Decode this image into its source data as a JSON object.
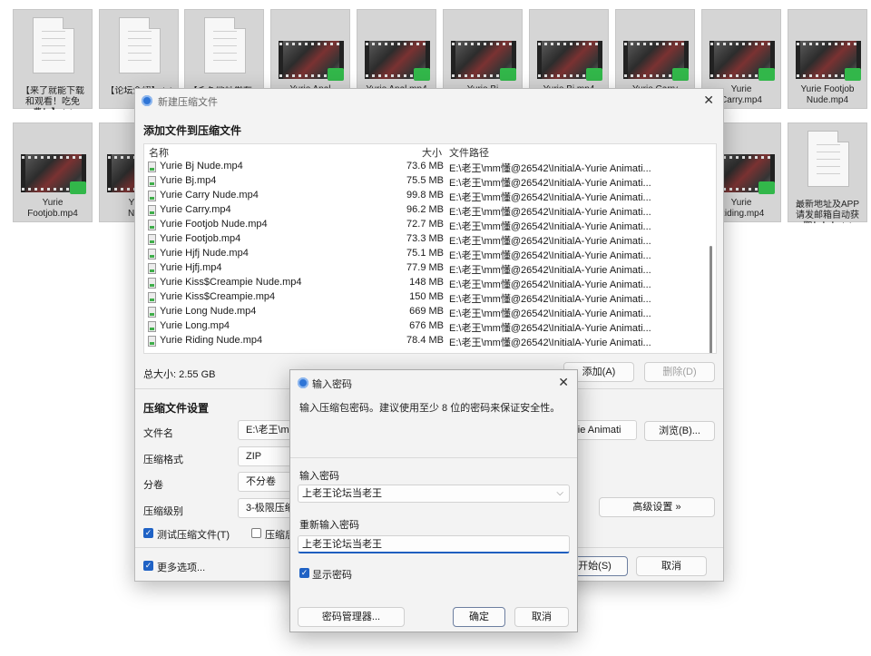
{
  "background_files": [
    {
      "type": "doc",
      "caption": "【来了就能下载\n和观看！吃免\n费！】.txt"
    },
    {
      "type": "doc",
      "caption": "【论坛介绍】.txt"
    },
    {
      "type": "doc",
      "caption": "【永久地址发布..."
    },
    {
      "type": "video",
      "caption": "Yurie Anal"
    },
    {
      "type": "video",
      "caption": "Yurie Anal.mp4"
    },
    {
      "type": "video",
      "caption": "Yurie Bj"
    },
    {
      "type": "video",
      "caption": "Yurie Bj.mp4"
    },
    {
      "type": "video",
      "caption": "Yurie Carry"
    },
    {
      "type": "video",
      "caption": "Yurie\nCarry.mp4"
    },
    {
      "type": "video",
      "caption": "Yurie Footjob\nNude.mp4"
    },
    {
      "type": "video",
      "caption": "Yurie\nFootjob.mp4"
    },
    {
      "type": "video",
      "caption": "Yurie\nNude"
    },
    {
      "type": "video",
      "caption": "Yurie\nRiding.mp4"
    },
    {
      "type": "doc",
      "caption": "最新地址及APP\n请发邮箱自动获\n取！！！.txt"
    }
  ],
  "main_window": {
    "title": "新建压缩文件",
    "section_add": "添加文件到压缩文件",
    "columns": {
      "name": "名称",
      "size": "大小",
      "path": "文件路径"
    },
    "files": [
      {
        "name": "Yurie Bj Nude.mp4",
        "size": "73.6 MB",
        "path": "E:\\老王\\mm懂@26542\\InitialA-Yurie Animati..."
      },
      {
        "name": "Yurie Bj.mp4",
        "size": "75.5 MB",
        "path": "E:\\老王\\mm懂@26542\\InitialA-Yurie Animati..."
      },
      {
        "name": "Yurie Carry Nude.mp4",
        "size": "99.8 MB",
        "path": "E:\\老王\\mm懂@26542\\InitialA-Yurie Animati..."
      },
      {
        "name": "Yurie Carry.mp4",
        "size": "96.2 MB",
        "path": "E:\\老王\\mm懂@26542\\InitialA-Yurie Animati..."
      },
      {
        "name": "Yurie Footjob Nude.mp4",
        "size": "72.7 MB",
        "path": "E:\\老王\\mm懂@26542\\InitialA-Yurie Animati..."
      },
      {
        "name": "Yurie Footjob.mp4",
        "size": "73.3 MB",
        "path": "E:\\老王\\mm懂@26542\\InitialA-Yurie Animati..."
      },
      {
        "name": "Yurie Hjfj Nude.mp4",
        "size": "75.1 MB",
        "path": "E:\\老王\\mm懂@26542\\InitialA-Yurie Animati..."
      },
      {
        "name": "Yurie Hjfj.mp4",
        "size": "77.9 MB",
        "path": "E:\\老王\\mm懂@26542\\InitialA-Yurie Animati..."
      },
      {
        "name": "Yurie Kiss$Creampie Nude.mp4",
        "size": "148 MB",
        "path": "E:\\老王\\mm懂@26542\\InitialA-Yurie Animati..."
      },
      {
        "name": "Yurie Kiss$Creampie.mp4",
        "size": "150 MB",
        "path": "E:\\老王\\mm懂@26542\\InitialA-Yurie Animati..."
      },
      {
        "name": "Yurie Long Nude.mp4",
        "size": "669 MB",
        "path": "E:\\老王\\mm懂@26542\\InitialA-Yurie Animati..."
      },
      {
        "name": "Yurie Long.mp4",
        "size": "676 MB",
        "path": "E:\\老王\\mm懂@26542\\InitialA-Yurie Animati..."
      },
      {
        "name": "Yurie Riding Nude.mp4",
        "size": "78.4 MB",
        "path": "E:\\老王\\mm懂@26542\\InitialA-Yurie Animati..."
      }
    ],
    "total_size": "总大小: 2.55 GB",
    "add_button": "添加(A)",
    "delete_button": "删除(D)",
    "section_settings": "压缩文件设置",
    "settings": {
      "filename_label": "文件名",
      "filename_value": "E:\\老王\\mm",
      "filename_tail": "urie Animati",
      "browse_button": "浏览(B)...",
      "format_label": "压缩格式",
      "format_value": "ZIP",
      "split_label": "分卷",
      "split_value": "不分卷",
      "level_label": "压缩级别",
      "level_value": "3-极限压缩",
      "advanced_button": "高级设置 »",
      "test_checkbox": "测试压缩文件(T)",
      "test_checked": true,
      "other_checkbox": "压缩后",
      "other_checked": false
    },
    "more_options": "更多选项...",
    "more_options_checked": true,
    "start_button": "开始(S)",
    "cancel_button": "取消"
  },
  "password_dialog": {
    "title": "输入密码",
    "description": "输入压缩包密码。建议使用至少 8 位的密码来保证安全性。",
    "password_label": "输入密码",
    "password_value": "上老王论坛当老王",
    "confirm_label": "重新输入密码",
    "confirm_value": "上老王论坛当老王",
    "show_password": "显示密码",
    "show_password_checked": true,
    "manager_button": "密码管理器...",
    "ok_button": "确定",
    "cancel_button": "取消"
  }
}
